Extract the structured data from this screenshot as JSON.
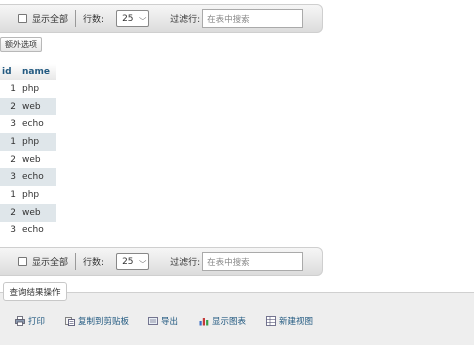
{
  "top_toolbar": {
    "show_all_label": "显示全部",
    "rows_label": "行数:",
    "rows_value": "25",
    "filter_label": "过滤行:",
    "filter_placeholder": "在表中搜索"
  },
  "extra_options_label": "额外选项",
  "table": {
    "headers": {
      "id": "id",
      "name": "name"
    },
    "rows": [
      {
        "id": "1",
        "name": "php"
      },
      {
        "id": "2",
        "name": "web"
      },
      {
        "id": "3",
        "name": "echo"
      },
      {
        "id": "1",
        "name": "php"
      },
      {
        "id": "2",
        "name": "web"
      },
      {
        "id": "3",
        "name": "echo"
      },
      {
        "id": "1",
        "name": "php"
      },
      {
        "id": "2",
        "name": "web"
      },
      {
        "id": "3",
        "name": "echo"
      }
    ]
  },
  "bottom_toolbar": {
    "show_all_label": "显示全部",
    "rows_label": "行数:",
    "rows_value": "25",
    "filter_label": "过滤行:",
    "filter_placeholder": "在表中搜索"
  },
  "query_ops": {
    "title": "查询结果操作",
    "links": [
      {
        "label": "打印",
        "icon": "print-icon"
      },
      {
        "label": "复制到剪贴板",
        "icon": "copy-icon"
      },
      {
        "label": "导出",
        "icon": "export-icon"
      },
      {
        "label": "显示图表",
        "icon": "chart-icon"
      },
      {
        "label": "新建视图",
        "icon": "view-icon"
      }
    ]
  }
}
